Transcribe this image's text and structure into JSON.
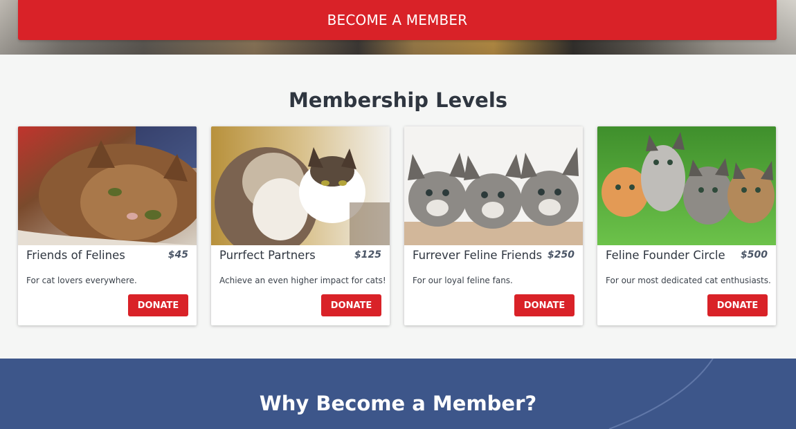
{
  "hero": {
    "button_label": "BECOME A MEMBER"
  },
  "levels": {
    "title": "Membership Levels",
    "cards": [
      {
        "name": "Friends of Felines",
        "price": "$45",
        "description": "For cat lovers everywhere.",
        "button_label": "DONATE",
        "image": "tabby-cat-lying-photo"
      },
      {
        "name": "Purrfect Partners",
        "price": "$125",
        "description": "Achieve an even higher impact for cats!",
        "button_label": "DONATE",
        "image": "two-cats-cuddling-photo"
      },
      {
        "name": "Furrever Feline Friends",
        "price": "$250",
        "description": "For our loyal feline fans.",
        "button_label": "DONATE",
        "image": "three-tabby-kittens-photo"
      },
      {
        "name": "Feline Founder Circle",
        "price": "$500",
        "description": "For our most dedicated cat enthusiasts.",
        "button_label": "DONATE",
        "image": "kittens-on-grass-photo"
      }
    ]
  },
  "why": {
    "title": "Why Become a Member?"
  },
  "colors": {
    "accent_red": "#d92228",
    "section_blue": "#3d568a",
    "text_dark": "#2f3640"
  }
}
